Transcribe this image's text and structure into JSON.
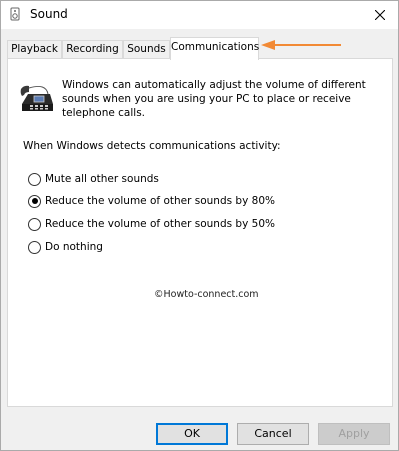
{
  "window": {
    "title": "Sound"
  },
  "tabs": [
    {
      "label": "Playback"
    },
    {
      "label": "Recording"
    },
    {
      "label": "Sounds"
    },
    {
      "label": "Communications",
      "active": true
    }
  ],
  "panel": {
    "description": "Windows can automatically adjust the volume of different sounds when you are using your PC to place or receive telephone calls.",
    "section_label": "When Windows detects communications activity:",
    "options": [
      {
        "label": "Mute all other sounds",
        "checked": false
      },
      {
        "label": "Reduce the volume of other sounds by 80%",
        "checked": true
      },
      {
        "label": "Reduce the volume of other sounds by 50%",
        "checked": false
      },
      {
        "label": "Do nothing",
        "checked": false
      }
    ],
    "watermark": "©Howto-connect.com"
  },
  "buttons": {
    "ok": "OK",
    "cancel": "Cancel",
    "apply": "Apply"
  },
  "colors": {
    "arrow": "#f28a35",
    "accent": "#0078d7"
  },
  "icons": {
    "title": "speaker-icon",
    "close": "close-icon",
    "phone": "telephone-icon",
    "annotation": "arrow-icon"
  }
}
